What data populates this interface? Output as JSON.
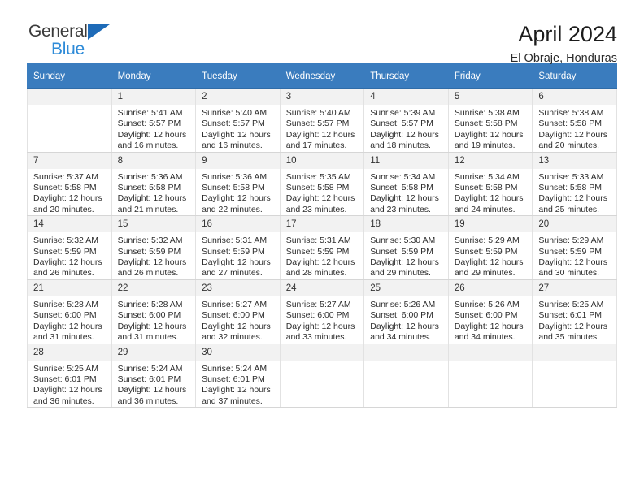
{
  "brand": {
    "name_top": "General",
    "name_bottom": "Blue",
    "accent_color": "#1e6bb8",
    "accent_light": "#2e8bd8"
  },
  "header": {
    "title": "April 2024",
    "subtitle": "El Obraje, Honduras"
  },
  "calendar": {
    "header_bg": "#3a7cbe",
    "daynum_bg": "#f2f2f2",
    "weekdays": [
      "Sunday",
      "Monday",
      "Tuesday",
      "Wednesday",
      "Thursday",
      "Friday",
      "Saturday"
    ],
    "labels": {
      "sunrise_prefix": "Sunrise:",
      "sunset_prefix": "Sunset:",
      "daylight_prefix": "Daylight:"
    },
    "weeks": [
      [
        {
          "day": "",
          "empty": true
        },
        {
          "day": "1",
          "sunrise": "Sunrise: 5:41 AM",
          "sunset": "Sunset: 5:57 PM",
          "daylight1": "Daylight: 12 hours",
          "daylight2": "and 16 minutes."
        },
        {
          "day": "2",
          "sunrise": "Sunrise: 5:40 AM",
          "sunset": "Sunset: 5:57 PM",
          "daylight1": "Daylight: 12 hours",
          "daylight2": "and 16 minutes."
        },
        {
          "day": "3",
          "sunrise": "Sunrise: 5:40 AM",
          "sunset": "Sunset: 5:57 PM",
          "daylight1": "Daylight: 12 hours",
          "daylight2": "and 17 minutes."
        },
        {
          "day": "4",
          "sunrise": "Sunrise: 5:39 AM",
          "sunset": "Sunset: 5:57 PM",
          "daylight1": "Daylight: 12 hours",
          "daylight2": "and 18 minutes."
        },
        {
          "day": "5",
          "sunrise": "Sunrise: 5:38 AM",
          "sunset": "Sunset: 5:58 PM",
          "daylight1": "Daylight: 12 hours",
          "daylight2": "and 19 minutes."
        },
        {
          "day": "6",
          "sunrise": "Sunrise: 5:38 AM",
          "sunset": "Sunset: 5:58 PM",
          "daylight1": "Daylight: 12 hours",
          "daylight2": "and 20 minutes."
        }
      ],
      [
        {
          "day": "7",
          "sunrise": "Sunrise: 5:37 AM",
          "sunset": "Sunset: 5:58 PM",
          "daylight1": "Daylight: 12 hours",
          "daylight2": "and 20 minutes."
        },
        {
          "day": "8",
          "sunrise": "Sunrise: 5:36 AM",
          "sunset": "Sunset: 5:58 PM",
          "daylight1": "Daylight: 12 hours",
          "daylight2": "and 21 minutes."
        },
        {
          "day": "9",
          "sunrise": "Sunrise: 5:36 AM",
          "sunset": "Sunset: 5:58 PM",
          "daylight1": "Daylight: 12 hours",
          "daylight2": "and 22 minutes."
        },
        {
          "day": "10",
          "sunrise": "Sunrise: 5:35 AM",
          "sunset": "Sunset: 5:58 PM",
          "daylight1": "Daylight: 12 hours",
          "daylight2": "and 23 minutes."
        },
        {
          "day": "11",
          "sunrise": "Sunrise: 5:34 AM",
          "sunset": "Sunset: 5:58 PM",
          "daylight1": "Daylight: 12 hours",
          "daylight2": "and 23 minutes."
        },
        {
          "day": "12",
          "sunrise": "Sunrise: 5:34 AM",
          "sunset": "Sunset: 5:58 PM",
          "daylight1": "Daylight: 12 hours",
          "daylight2": "and 24 minutes."
        },
        {
          "day": "13",
          "sunrise": "Sunrise: 5:33 AM",
          "sunset": "Sunset: 5:58 PM",
          "daylight1": "Daylight: 12 hours",
          "daylight2": "and 25 minutes."
        }
      ],
      [
        {
          "day": "14",
          "sunrise": "Sunrise: 5:32 AM",
          "sunset": "Sunset: 5:59 PM",
          "daylight1": "Daylight: 12 hours",
          "daylight2": "and 26 minutes."
        },
        {
          "day": "15",
          "sunrise": "Sunrise: 5:32 AM",
          "sunset": "Sunset: 5:59 PM",
          "daylight1": "Daylight: 12 hours",
          "daylight2": "and 26 minutes."
        },
        {
          "day": "16",
          "sunrise": "Sunrise: 5:31 AM",
          "sunset": "Sunset: 5:59 PM",
          "daylight1": "Daylight: 12 hours",
          "daylight2": "and 27 minutes."
        },
        {
          "day": "17",
          "sunrise": "Sunrise: 5:31 AM",
          "sunset": "Sunset: 5:59 PM",
          "daylight1": "Daylight: 12 hours",
          "daylight2": "and 28 minutes."
        },
        {
          "day": "18",
          "sunrise": "Sunrise: 5:30 AM",
          "sunset": "Sunset: 5:59 PM",
          "daylight1": "Daylight: 12 hours",
          "daylight2": "and 29 minutes."
        },
        {
          "day": "19",
          "sunrise": "Sunrise: 5:29 AM",
          "sunset": "Sunset: 5:59 PM",
          "daylight1": "Daylight: 12 hours",
          "daylight2": "and 29 minutes."
        },
        {
          "day": "20",
          "sunrise": "Sunrise: 5:29 AM",
          "sunset": "Sunset: 5:59 PM",
          "daylight1": "Daylight: 12 hours",
          "daylight2": "and 30 minutes."
        }
      ],
      [
        {
          "day": "21",
          "sunrise": "Sunrise: 5:28 AM",
          "sunset": "Sunset: 6:00 PM",
          "daylight1": "Daylight: 12 hours",
          "daylight2": "and 31 minutes."
        },
        {
          "day": "22",
          "sunrise": "Sunrise: 5:28 AM",
          "sunset": "Sunset: 6:00 PM",
          "daylight1": "Daylight: 12 hours",
          "daylight2": "and 31 minutes."
        },
        {
          "day": "23",
          "sunrise": "Sunrise: 5:27 AM",
          "sunset": "Sunset: 6:00 PM",
          "daylight1": "Daylight: 12 hours",
          "daylight2": "and 32 minutes."
        },
        {
          "day": "24",
          "sunrise": "Sunrise: 5:27 AM",
          "sunset": "Sunset: 6:00 PM",
          "daylight1": "Daylight: 12 hours",
          "daylight2": "and 33 minutes."
        },
        {
          "day": "25",
          "sunrise": "Sunrise: 5:26 AM",
          "sunset": "Sunset: 6:00 PM",
          "daylight1": "Daylight: 12 hours",
          "daylight2": "and 34 minutes."
        },
        {
          "day": "26",
          "sunrise": "Sunrise: 5:26 AM",
          "sunset": "Sunset: 6:00 PM",
          "daylight1": "Daylight: 12 hours",
          "daylight2": "and 34 minutes."
        },
        {
          "day": "27",
          "sunrise": "Sunrise: 5:25 AM",
          "sunset": "Sunset: 6:01 PM",
          "daylight1": "Daylight: 12 hours",
          "daylight2": "and 35 minutes."
        }
      ],
      [
        {
          "day": "28",
          "sunrise": "Sunrise: 5:25 AM",
          "sunset": "Sunset: 6:01 PM",
          "daylight1": "Daylight: 12 hours",
          "daylight2": "and 36 minutes."
        },
        {
          "day": "29",
          "sunrise": "Sunrise: 5:24 AM",
          "sunset": "Sunset: 6:01 PM",
          "daylight1": "Daylight: 12 hours",
          "daylight2": "and 36 minutes."
        },
        {
          "day": "30",
          "sunrise": "Sunrise: 5:24 AM",
          "sunset": "Sunset: 6:01 PM",
          "daylight1": "Daylight: 12 hours",
          "daylight2": "and 37 minutes."
        },
        {
          "day": "",
          "empty": true
        },
        {
          "day": "",
          "empty": true
        },
        {
          "day": "",
          "empty": true
        },
        {
          "day": "",
          "empty": true
        }
      ]
    ]
  }
}
